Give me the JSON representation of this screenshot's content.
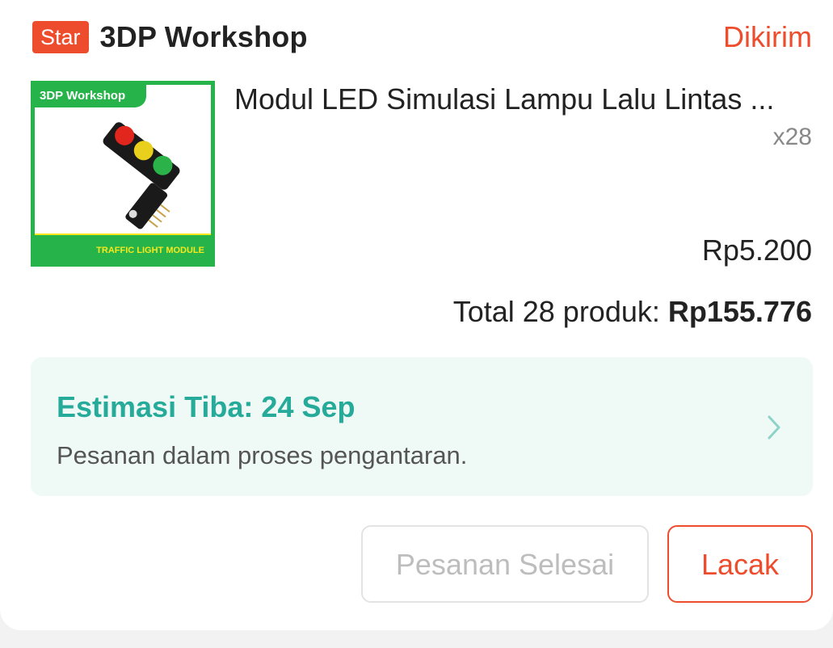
{
  "shop": {
    "badge": "Star",
    "name": "3DP Workshop",
    "status": "Dikirim"
  },
  "product": {
    "thumbnail": {
      "top_label": "3DP Workshop",
      "bottom_label": "TRAFFIC LIGHT MODULE"
    },
    "name": "Modul LED Simulasi Lampu Lalu Lintas ...",
    "quantity": "x28",
    "price": "Rp5.200"
  },
  "total": {
    "label": "Total 28 produk: ",
    "amount": "Rp155.776"
  },
  "shipping": {
    "eta": "Estimasi Tiba: 24 Sep",
    "description": "Pesanan dalam proses pengantaran.",
    "icon": "chevron-right-icon"
  },
  "actions": {
    "completed_label": "Pesanan Selesai",
    "track_label": "Lacak"
  },
  "colors": {
    "accent": "#ee4d2d",
    "teal": "#26aa99",
    "shipping_bg": "#effaf7"
  }
}
